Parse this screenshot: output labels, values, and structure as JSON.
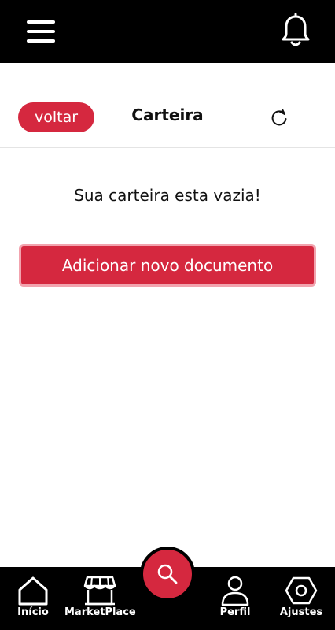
{
  "header": {
    "menu_icon": "hamburger-menu-icon",
    "notification_icon": "bell-icon"
  },
  "subheader": {
    "back_label": "voltar",
    "title": "Carteira",
    "refresh_icon": "refresh-icon"
  },
  "main": {
    "empty_message": "Sua carteira esta vazia!",
    "add_button_label": "Adicionar novo documento"
  },
  "bottom_nav": {
    "items": [
      {
        "label": "Início",
        "icon": "home-icon"
      },
      {
        "label": "MarketPlace",
        "icon": "store-icon"
      },
      {
        "label": "Perfil",
        "icon": "user-icon"
      },
      {
        "label": "Ajustes",
        "icon": "settings-hexagon-icon"
      }
    ],
    "fab_icon": "search-icon"
  },
  "colors": {
    "accent": "#d5283f",
    "accent_border": "#f2a3ae",
    "bar_background": "#000000",
    "background": "#ffffff"
  }
}
